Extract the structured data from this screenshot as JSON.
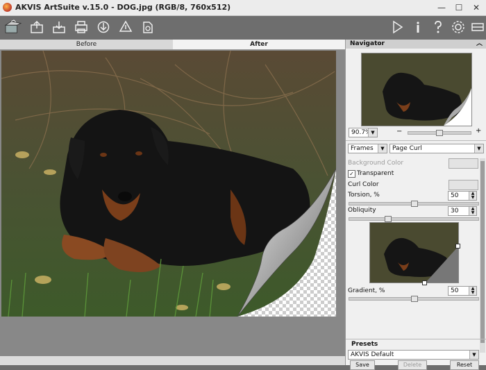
{
  "window": {
    "title": "AKVIS ArtSuite v.15.0 - DOG.jpg (RGB/8, 760x512)",
    "min": "—",
    "max": "☐",
    "close": "✕"
  },
  "tabs": {
    "before": "Before",
    "after": "After"
  },
  "navigator": {
    "title": "Navigator",
    "zoom": "90.7%",
    "zoom_out": "−",
    "zoom_in": "+"
  },
  "effect": {
    "category": "Frames",
    "type": "Page Curl"
  },
  "settings": {
    "background_color": "Background Color",
    "transparent": "Transparent",
    "curl_color": "Curl Color",
    "torsion_label": "Torsion, %",
    "torsion_value": "50",
    "obliquity_label": "Obliquity",
    "obliquity_value": "30",
    "gradient_label": "Gradient, %",
    "gradient_value": "50"
  },
  "presets": {
    "title": "Presets",
    "selected": "AKVIS Default",
    "save": "Save",
    "delete": "Delete",
    "reset": "Reset"
  },
  "icons": [
    "logo-icon",
    "open-icon",
    "save-icon",
    "print-icon",
    "share-icon",
    "batch-icon",
    "plugin-icon",
    "run-icon",
    "info-icon",
    "help-icon",
    "settings-icon",
    "collapse-icon"
  ]
}
